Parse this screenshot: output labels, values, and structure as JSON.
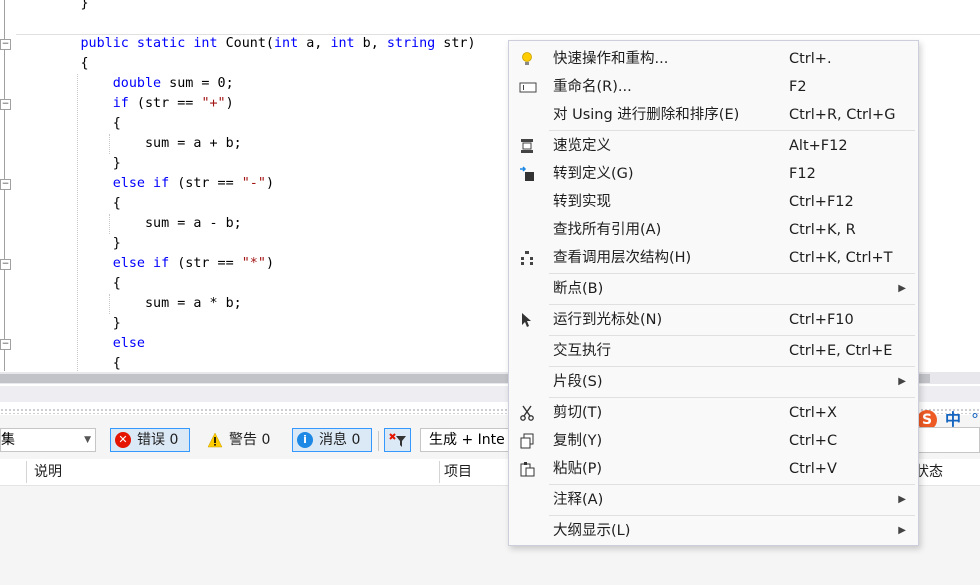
{
  "editor": {
    "lines": [
      {
        "parts": [
          {
            "t": "        }",
            "c": ""
          }
        ]
      },
      {
        "parts": [
          {
            "t": "",
            "c": ""
          }
        ]
      },
      {
        "parts": [
          {
            "t": "        ",
            "c": ""
          },
          {
            "t": "public static int",
            "c": "kw"
          },
          {
            "t": " Count(",
            "c": ""
          },
          {
            "t": "int",
            "c": "kw"
          },
          {
            "t": " a, ",
            "c": ""
          },
          {
            "t": "int",
            "c": "kw"
          },
          {
            "t": " b, ",
            "c": ""
          },
          {
            "t": "string",
            "c": "kw"
          },
          {
            "t": " str)",
            "c": ""
          }
        ]
      },
      {
        "parts": [
          {
            "t": "        {",
            "c": ""
          }
        ]
      },
      {
        "parts": [
          {
            "t": "            ",
            "c": ""
          },
          {
            "t": "double",
            "c": "kw"
          },
          {
            "t": " sum = 0;",
            "c": ""
          }
        ]
      },
      {
        "parts": [
          {
            "t": "            ",
            "c": ""
          },
          {
            "t": "if",
            "c": "kw"
          },
          {
            "t": " (str == ",
            "c": ""
          },
          {
            "t": "\"+\"",
            "c": "str"
          },
          {
            "t": ")",
            "c": ""
          }
        ]
      },
      {
        "parts": [
          {
            "t": "            {",
            "c": ""
          }
        ]
      },
      {
        "parts": [
          {
            "t": "                sum = a + b;",
            "c": ""
          }
        ]
      },
      {
        "parts": [
          {
            "t": "            }",
            "c": ""
          }
        ]
      },
      {
        "parts": [
          {
            "t": "            ",
            "c": ""
          },
          {
            "t": "else if",
            "c": "kw"
          },
          {
            "t": " (str == ",
            "c": ""
          },
          {
            "t": "\"-\"",
            "c": "str"
          },
          {
            "t": ")",
            "c": ""
          }
        ]
      },
      {
        "parts": [
          {
            "t": "            {",
            "c": ""
          }
        ]
      },
      {
        "parts": [
          {
            "t": "                sum = a - b;",
            "c": ""
          }
        ]
      },
      {
        "parts": [
          {
            "t": "            }",
            "c": ""
          }
        ]
      },
      {
        "parts": [
          {
            "t": "            ",
            "c": ""
          },
          {
            "t": "else if",
            "c": "kw"
          },
          {
            "t": " (str == ",
            "c": ""
          },
          {
            "t": "\"*\"",
            "c": "str"
          },
          {
            "t": ")",
            "c": ""
          }
        ]
      },
      {
        "parts": [
          {
            "t": "            {",
            "c": ""
          }
        ]
      },
      {
        "parts": [
          {
            "t": "                sum = a * b;",
            "c": ""
          }
        ]
      },
      {
        "parts": [
          {
            "t": "            }",
            "c": ""
          }
        ]
      },
      {
        "parts": [
          {
            "t": "            ",
            "c": ""
          },
          {
            "t": "else",
            "c": "kw"
          }
        ]
      },
      {
        "parts": [
          {
            "t": "            {",
            "c": ""
          }
        ]
      }
    ],
    "collapse_glyph": "−"
  },
  "error_list": {
    "scope_value": "集",
    "errors_label": "错误 0",
    "warnings_label": "警告 0",
    "messages_label": "消息 0",
    "build_filter_value": "生成 + Inte",
    "columns": [
      "说明",
      "项目",
      "状态"
    ]
  },
  "ime": {
    "logo": "S",
    "mode": "中",
    "punct": "°"
  },
  "context_menu": {
    "items": [
      {
        "name": "quick-actions",
        "icon": "lightbulb-icon",
        "label": "快速操作和重构...",
        "shortcut": "Ctrl+.",
        "submenu": false
      },
      {
        "name": "rename",
        "icon": "rename-icon",
        "label": "重命名(R)...",
        "shortcut": "F2",
        "submenu": false
      },
      {
        "name": "remove-sort-usings",
        "icon": "",
        "label": "对 Using 进行删除和排序(E)",
        "shortcut": "Ctrl+R, Ctrl+G",
        "submenu": false
      },
      {
        "sep": true
      },
      {
        "name": "peek-definition",
        "icon": "peek-definition-icon",
        "label": "速览定义",
        "shortcut": "Alt+F12",
        "submenu": false
      },
      {
        "name": "go-to-definition",
        "icon": "go-to-definition-icon",
        "label": "转到定义(G)",
        "shortcut": "F12",
        "submenu": false
      },
      {
        "name": "go-to-implementation",
        "icon": "",
        "label": "转到实现",
        "shortcut": "Ctrl+F12",
        "submenu": false
      },
      {
        "name": "find-all-references",
        "icon": "",
        "label": "查找所有引用(A)",
        "shortcut": "Ctrl+K, R",
        "submenu": false
      },
      {
        "name": "view-call-hierarchy",
        "icon": "call-hierarchy-icon",
        "label": "查看调用层次结构(H)",
        "shortcut": "Ctrl+K, Ctrl+T",
        "submenu": false
      },
      {
        "sep": true
      },
      {
        "name": "breakpoint",
        "icon": "",
        "label": "断点(B)",
        "shortcut": "",
        "submenu": true
      },
      {
        "sep": true
      },
      {
        "name": "run-to-cursor",
        "icon": "cursor-icon",
        "label": "运行到光标处(N)",
        "shortcut": "Ctrl+F10",
        "submenu": false
      },
      {
        "sep": true
      },
      {
        "name": "execute-interactive",
        "icon": "",
        "label": "交互执行",
        "shortcut": "Ctrl+E, Ctrl+E",
        "submenu": false
      },
      {
        "sep": true
      },
      {
        "name": "snippet",
        "icon": "",
        "label": "片段(S)",
        "shortcut": "",
        "submenu": true
      },
      {
        "sep": true
      },
      {
        "name": "cut",
        "icon": "scissors-icon",
        "label": "剪切(T)",
        "shortcut": "Ctrl+X",
        "submenu": false
      },
      {
        "name": "copy",
        "icon": "copy-icon",
        "label": "复制(Y)",
        "shortcut": "Ctrl+C",
        "submenu": false
      },
      {
        "name": "paste",
        "icon": "paste-icon",
        "label": "粘贴(P)",
        "shortcut": "Ctrl+V",
        "submenu": false
      },
      {
        "sep": true
      },
      {
        "name": "comment",
        "icon": "",
        "label": "注释(A)",
        "shortcut": "",
        "submenu": true
      },
      {
        "sep": true
      },
      {
        "name": "outlining",
        "icon": "",
        "label": "大纲显示(L)",
        "shortcut": "",
        "submenu": true
      }
    ],
    "submenu_arrow": "▶"
  },
  "colors": {
    "keyword": "#0000ff",
    "string": "#a31515",
    "error": "#e51400",
    "warning": "#ffcc00",
    "info": "#1e88e5",
    "active_filter": "#3399ff"
  }
}
